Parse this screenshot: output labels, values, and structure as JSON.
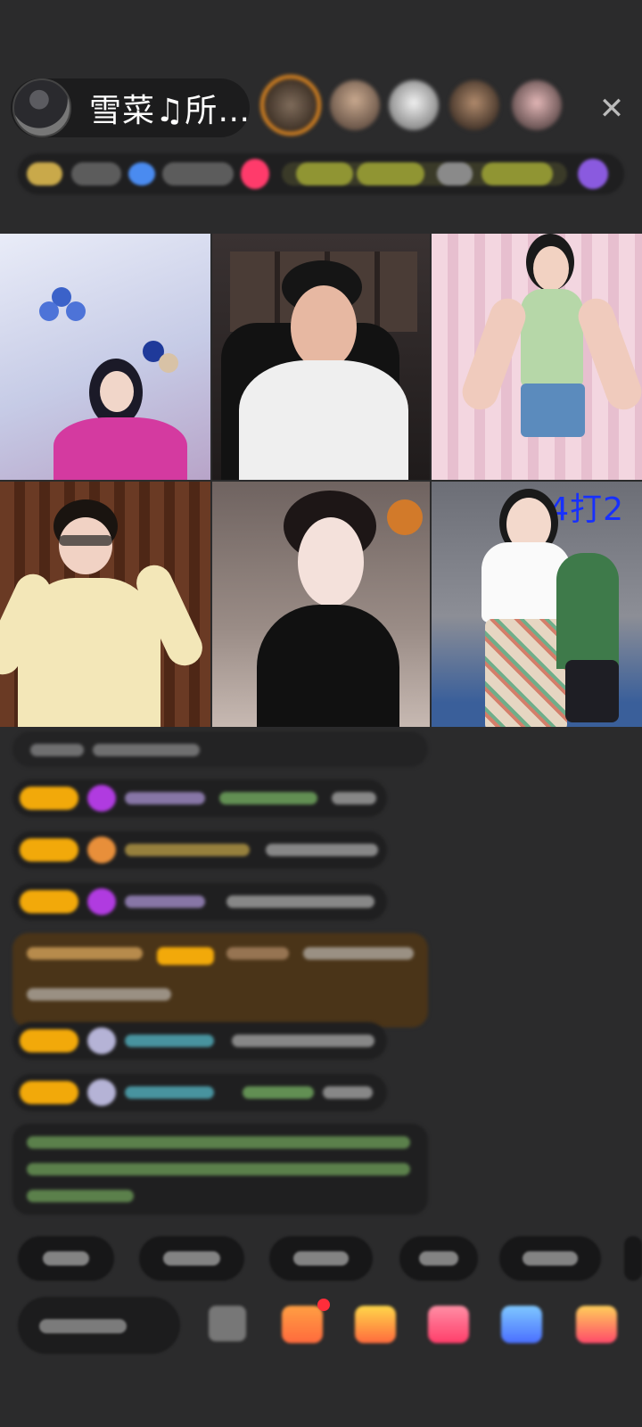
{
  "header": {
    "host_name": "雪菜♫所…",
    "close_glyph": "✕",
    "viewer_count_avatars": 5
  },
  "stage": {
    "score_label": "4打2"
  },
  "colors": {
    "background": "#2b2b2c",
    "accent_orange": "#e58a20",
    "badge_yellow": "#f2a90a",
    "score_blue": "#1730ff"
  }
}
